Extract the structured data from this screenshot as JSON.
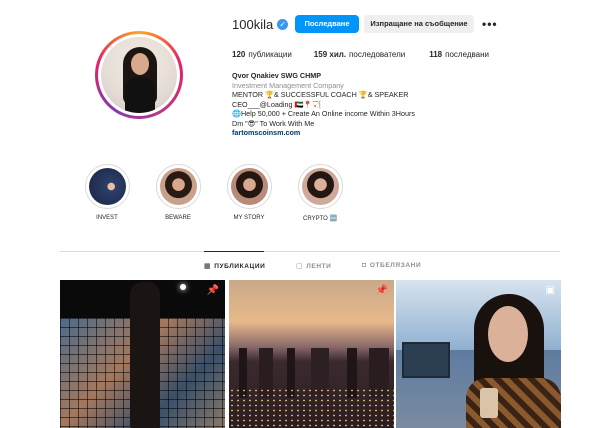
{
  "profile": {
    "username": "100kila",
    "follow_label": "Последване",
    "message_label": "Изпращане на съобщение",
    "more_label": "•••",
    "stats": {
      "posts_value": "120",
      "posts_label": "публикации",
      "followers_value": "159 хил.",
      "followers_label": "последователи",
      "following_value": "118",
      "following_label": "последвани"
    },
    "bio": {
      "name": "Qvor Qnakiev SWG CHMP",
      "category": "Investment Management Company",
      "line1": "MENTOR 🏆& SUCCESSFUL COACH 🏆& SPEAKER",
      "line2": "CEO___@Loading 🇦🇪📍🏹",
      "line3": "🌐Help 50,000 + Create An Online income Within 3Hours",
      "line4": "Dm \"😎\" To Work With Me",
      "link": "fartomscoinsm.com"
    }
  },
  "highlights": [
    {
      "label": "INVEST",
      "color": "#2c3e6a"
    },
    {
      "label": "BEWARE",
      "color": "#c9a08a"
    },
    {
      "label": "MY STORY",
      "color": "#b88a78"
    },
    {
      "label": "CRYPTO 🆒",
      "color": "#d0a89a"
    }
  ],
  "tabs": {
    "posts": "ПУБЛИКАЦИИ",
    "reels": "ЛЕНТИ",
    "tagged": "ОТБЕЛЯЗАНИ"
  },
  "icons": {
    "verified": "verified-badge-icon",
    "pin": "pin-icon",
    "reel": "reel-icon"
  },
  "colors": {
    "accent": "#0095f6",
    "verified": "#3897f0"
  }
}
